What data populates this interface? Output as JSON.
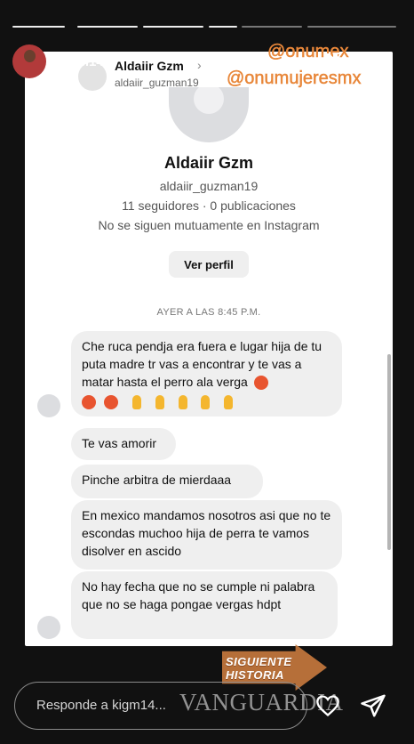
{
  "story": {
    "poster_username": "kigm14",
    "progress_segments": 6,
    "active_segment": 5,
    "mentions": [
      "@onumex",
      "@onumujeresmx"
    ],
    "next_story_label_line1": "SIGUIENTE",
    "next_story_label_line2": "HISTORIA",
    "reply_placeholder": "Responde a kigm14...",
    "watermark": "VANGUARDIA"
  },
  "screenshot": {
    "header_name": "Aldaiir Gzm",
    "header_handle": "aldaiir_guzman19",
    "profile_name": "Aldaiir Gzm",
    "profile_handle": "aldaiir_guzman19",
    "profile_stats": "11 seguidores · 0 publicaciones",
    "profile_mutual": "No se siguen mutuamente en Instagram",
    "view_profile_label": "Ver perfil",
    "timestamp": "AYER A LAS 8:45 P.M.",
    "messages": [
      "Che ruca pendja era fuera e lugar hija de tu puta madre tr vas a encontrar y te vas a matar hasta el perro ala verga",
      "Te vas amorir",
      "Pinche arbitra  de mierdaaa",
      "En mexico mandamos nosotros asi que no te escondas muchoo hija de perra te vamos disolver en ascido",
      "No hay fecha que no se cumple ni palabra que no se haga pongae vergas hdpt"
    ]
  },
  "colors": {
    "story_bg": "#111111",
    "mention": "#e8873a",
    "bubble": "#efefef",
    "next_sticker": "#c97a3e"
  }
}
